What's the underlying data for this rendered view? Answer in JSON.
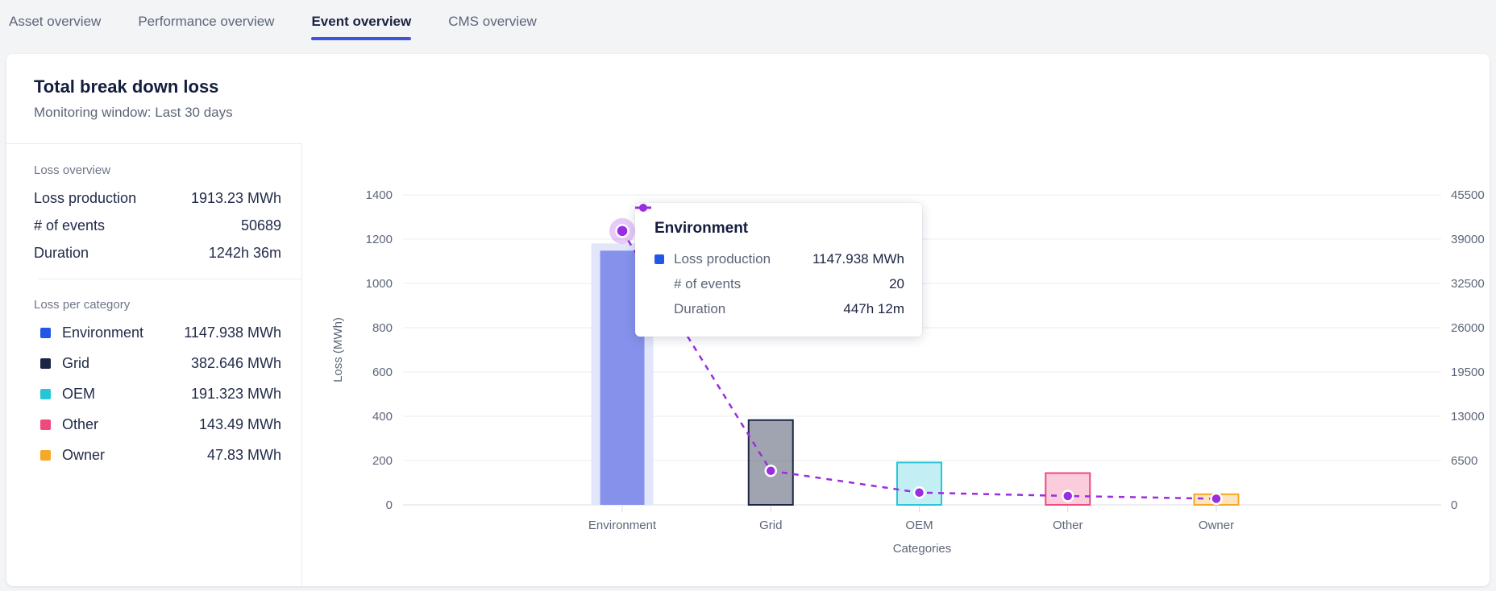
{
  "theme": {
    "accent": "#3c55d9",
    "text_dark": "#1b2342",
    "text_gray": "#5d6678",
    "card_bg": "#ffffff",
    "page_bg": "#f3f4f6"
  },
  "tabs": {
    "items": [
      {
        "label": "Asset overview",
        "active": false
      },
      {
        "label": "Performance overview",
        "active": false
      },
      {
        "label": "Event overview",
        "active": true
      },
      {
        "label": "CMS overview",
        "active": false
      }
    ]
  },
  "panel": {
    "title": "Total break down loss",
    "subtitle": "Monitoring window: Last 30 days",
    "loss_overview": {
      "heading": "Loss overview",
      "rows": [
        {
          "label": "Loss production",
          "value": "1913.23 MWh"
        },
        {
          "label": "# of events",
          "value": "50689"
        },
        {
          "label": "Duration",
          "value": "1242h 36m"
        }
      ]
    },
    "loss_per_category": {
      "heading": "Loss per category",
      "rows": [
        {
          "label": "Environment",
          "value": "1147.938 MWh",
          "color": "#2156e8"
        },
        {
          "label": "Grid",
          "value": "382.646 MWh",
          "color": "#1d2544"
        },
        {
          "label": "OEM",
          "value": "191.323 MWh",
          "color": "#28c5d8"
        },
        {
          "label": "Other",
          "value": "143.49 MWh",
          "color": "#ef497d"
        },
        {
          "label": "Owner",
          "value": "47.83 MWh",
          "color": "#f6a827"
        }
      ]
    }
  },
  "tooltip": {
    "title": "Environment",
    "rows": [
      {
        "marker": "square",
        "color": "#2156e8",
        "label": "Loss production",
        "value": "1147.938 MWh"
      },
      {
        "marker": "none",
        "color": "",
        "label": "# of events",
        "value": "20"
      },
      {
        "marker": "line-dot",
        "color": "#9a2de0",
        "label": "Duration",
        "value": "447h 12m"
      }
    ]
  },
  "chart_data": {
    "type": "bar+line",
    "categories": [
      "Environment",
      "Grid",
      "OEM",
      "Other",
      "Owner"
    ],
    "series": [
      {
        "name": "Loss production",
        "type": "bar",
        "unit": "MWh",
        "axis": "left",
        "values": [
          1147.938,
          382.646,
          191.323,
          143.49,
          47.83
        ]
      },
      {
        "name": "Duration",
        "type": "line",
        "style": "dashed",
        "axis": "right",
        "values_right_axis_approx": [
          40200,
          5000,
          1800,
          1300,
          900
        ],
        "known_labels": [
          "447h 12m",
          null,
          null,
          null,
          null
        ]
      }
    ],
    "x_axis": {
      "label": "Categories"
    },
    "left_axis": {
      "label": "Loss (MWh)",
      "ticks": [
        0,
        200,
        400,
        600,
        800,
        1000,
        1200,
        1400
      ],
      "max": 1400
    },
    "right_axis": {
      "label": "",
      "ticks": [
        0,
        6500,
        13000,
        19500,
        26000,
        32500,
        39000,
        45500
      ],
      "max": 45500
    },
    "grid": true,
    "highlighted_category": "Environment",
    "legend_position": "none",
    "colors": {
      "bars": [
        {
          "fill": "#8691ec",
          "border": ""
        },
        {
          "fill": "rgba(29,37,68,0.42)",
          "border": "#1d2544"
        },
        {
          "fill": "rgba(39,197,216,0.28)",
          "border": "#29c5d8"
        },
        {
          "fill": "rgba(240,73,124,0.28)",
          "border": "#ef497d"
        },
        {
          "fill": "rgba(246,168,39,0.30)",
          "border": "#f6a827"
        }
      ],
      "line": "#9a2de0",
      "highlight_band": "#e2e6fa",
      "gridline": "#ebecf1",
      "axis_line": "#dcdde4"
    }
  }
}
